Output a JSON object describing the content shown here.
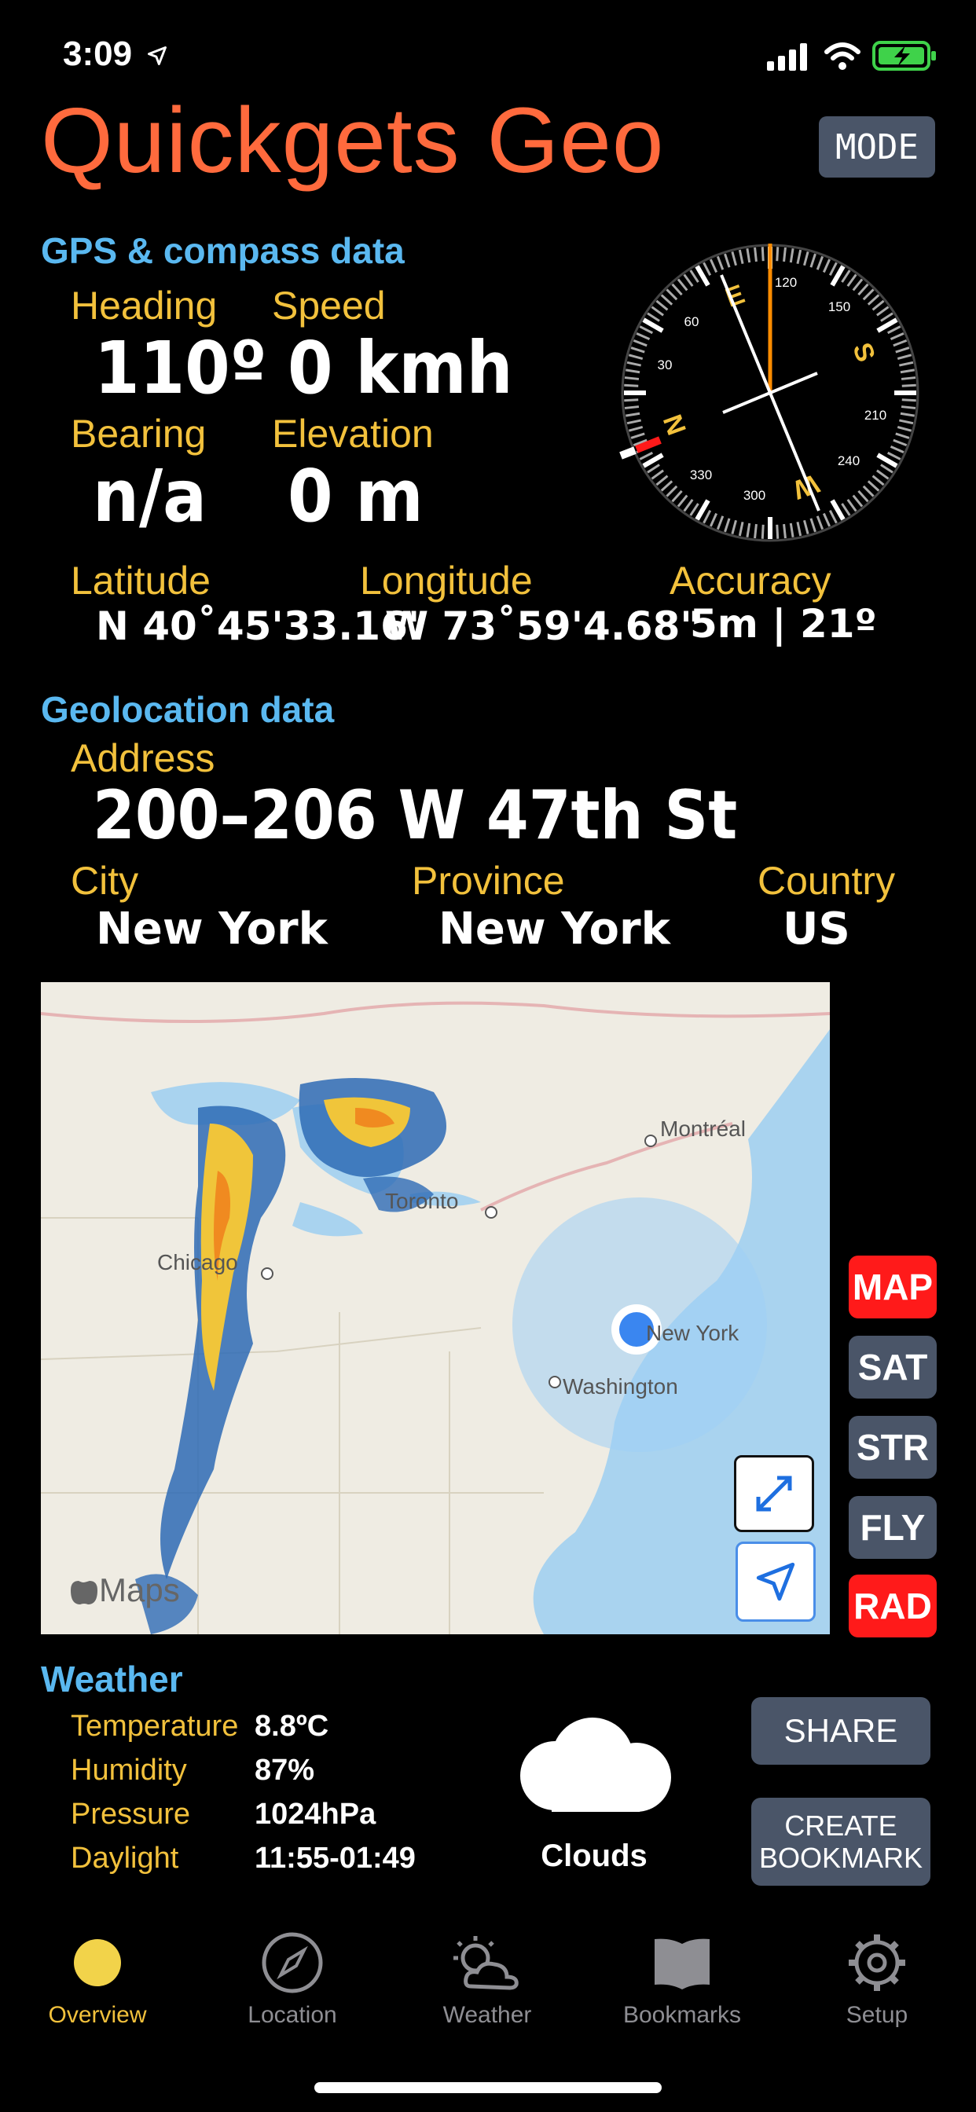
{
  "status_bar": {
    "time": "3:09"
  },
  "app": {
    "title": "Quickgets Geo",
    "mode_label": "MODE"
  },
  "gps": {
    "section_title": "GPS & compass data",
    "heading_label": "Heading",
    "heading_value": "110º",
    "speed_label": "Speed",
    "speed_value": "0 kmh",
    "bearing_label": "Bearing",
    "bearing_value": "n/a",
    "elevation_label": "Elevation",
    "elevation_value": "0 m",
    "latitude_label": "Latitude",
    "latitude_value": "N 40˚45'33.16\"",
    "longitude_label": "Longitude",
    "longitude_value": "W 73˚59'4.68\"",
    "accuracy_label": "Accuracy",
    "accuracy_value": "5m | 21º"
  },
  "compass": {
    "heading_degrees": 110,
    "cardinals": [
      "N",
      "E",
      "S",
      "W"
    ],
    "ticks": [
      "30",
      "60",
      "120",
      "150",
      "210",
      "240",
      "300",
      "330"
    ]
  },
  "geo": {
    "section_title": "Geolocation data",
    "address_label": "Address",
    "address_value": "200–206 W 47th St",
    "city_label": "City",
    "city_value": "New York",
    "province_label": "Province",
    "province_value": "New York",
    "country_label": "Country",
    "country_value": "US"
  },
  "map": {
    "cities": [
      "Montréal",
      "Toronto",
      "Chicago",
      "New York",
      "Washington"
    ],
    "attribution": "Maps",
    "side_buttons": [
      {
        "label": "MAP",
        "color": "#ff1a1a"
      },
      {
        "label": "SAT",
        "color": "#4a5568"
      },
      {
        "label": "STR",
        "color": "#4a5568"
      },
      {
        "label": "FLY",
        "color": "#4a5568"
      },
      {
        "label": "RAD",
        "color": "#ff1a1a"
      }
    ]
  },
  "weather": {
    "section_title": "Weather",
    "temperature_label": "Temperature",
    "temperature_value": "8.8ºC",
    "humidity_label": "Humidity",
    "humidity_value": "87%",
    "pressure_label": "Pressure",
    "pressure_value": "1024hPa",
    "daylight_label": "Daylight",
    "daylight_value": "11:55-01:49",
    "condition": "Clouds",
    "share_label": "SHARE",
    "bookmark_label_1": "CREATE",
    "bookmark_label_2": "BOOKMARK"
  },
  "tabs": [
    {
      "label": "Overview",
      "icon": "dot-icon",
      "active": true
    },
    {
      "label": "Location",
      "icon": "compass-icon",
      "active": false
    },
    {
      "label": "Weather",
      "icon": "sun-cloud-icon",
      "active": false
    },
    {
      "label": "Bookmarks",
      "icon": "book-icon",
      "active": false
    },
    {
      "label": "Setup",
      "icon": "gear-icon",
      "active": false
    }
  ],
  "colors": {
    "accent_orange": "#ff6a3d",
    "label_yellow": "#f2c13c",
    "section_blue": "#5ab8f0",
    "button_gray": "#4a5568",
    "alert_red": "#ff1a1a",
    "active_tab": "#f2c13c"
  }
}
